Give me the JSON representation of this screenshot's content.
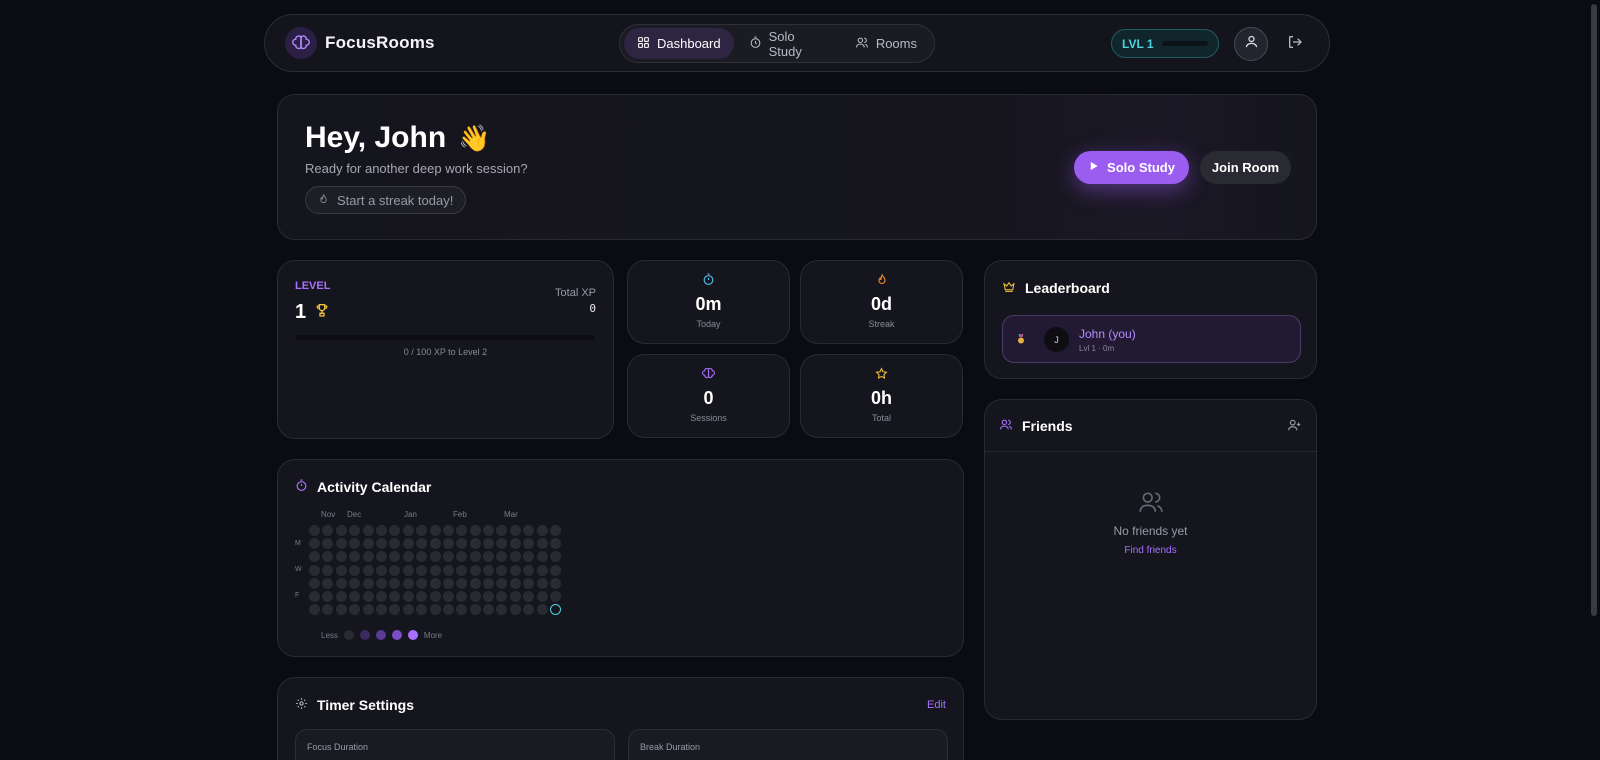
{
  "nav": {
    "brand": "FocusRooms",
    "tabs": [
      {
        "label": "Dashboard",
        "icon": "grid-icon",
        "active": true
      },
      {
        "label": "Solo Study",
        "icon": "timer-icon",
        "active": false
      },
      {
        "label": "Rooms",
        "icon": "users-icon",
        "active": false
      }
    ],
    "level_badge": "LVL 1",
    "level_progress": 0
  },
  "hero": {
    "greeting": "Hey, John",
    "wave_emoji": "👋",
    "subtitle": "Ready for another deep work session?",
    "streak_text": "Start a streak today!",
    "solo_button": "Solo Study",
    "join_button": "Join Room"
  },
  "level": {
    "label": "LEVEL",
    "value": "1",
    "total_xp_label": "Total XP",
    "total_xp_value": "0",
    "progress_text": "0 / 100 XP to Level 2",
    "progress_fraction": 0
  },
  "stats": [
    {
      "value": "0m",
      "label": "Today",
      "icon": "timer-icon",
      "color": "#4fb6e0"
    },
    {
      "value": "0d",
      "label": "Streak",
      "icon": "flame-icon",
      "color": "#f08a30"
    },
    {
      "value": "0",
      "label": "Sessions",
      "icon": "brain-icon",
      "color": "#a970ff"
    },
    {
      "value": "0h",
      "label": "Total",
      "icon": "star-icon",
      "color": "#f0c040"
    }
  ],
  "leaderboard": {
    "title": "Leaderboard",
    "entries": [
      {
        "avatar": "J",
        "name": "John (you)",
        "meta": "Lvl 1 · 0m"
      }
    ]
  },
  "friends": {
    "title": "Friends",
    "empty_text": "No friends yet",
    "find_link": "Find friends"
  },
  "calendar": {
    "title": "Activity Calendar",
    "months": [
      "Nov",
      "Dec",
      "Jan",
      "Feb",
      "Mar"
    ],
    "day_labels": [
      "",
      "M",
      "",
      "W",
      "",
      "F",
      ""
    ],
    "legend_less": "Less",
    "legend_more": "More",
    "legend_colors": [
      "#2a2a33",
      "#3c2a5e",
      "#5a3a92",
      "#7b4cc8",
      "#a970ff"
    ]
  },
  "timer": {
    "title": "Timer Settings",
    "edit_link": "Edit",
    "focus_label": "Focus Duration",
    "break_label": "Break Duration"
  }
}
